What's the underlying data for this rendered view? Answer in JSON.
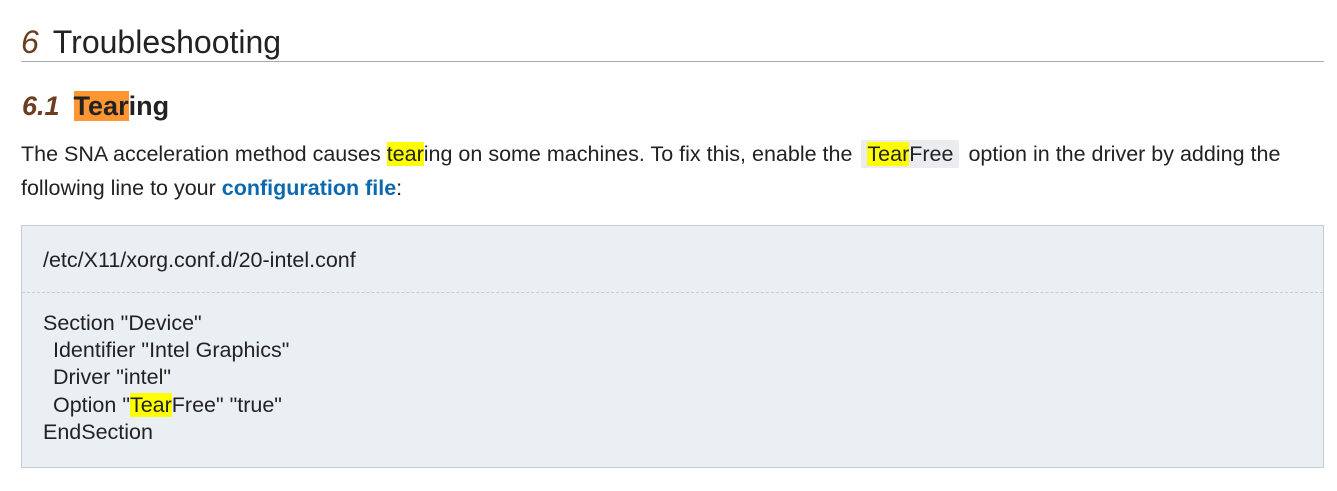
{
  "section": {
    "number": "6",
    "title": "Troubleshooting"
  },
  "subsection": {
    "number": "6.1",
    "title_highlight": "Tear",
    "title_rest": "ing"
  },
  "paragraph": {
    "part1": "The SNA acceleration method causes ",
    "highlight1": "tear",
    "part2": "ing on some machines. To fix this, enable the",
    "code_highlight": "Tear",
    "code_rest": "Free",
    "part3": "option in the driver by adding the following line to your ",
    "link_text": "configuration file",
    "part4": ":"
  },
  "codebox": {
    "filename": "/etc/X11/xorg.conf.d/20-intel.conf",
    "line1": "Section \"Device\"",
    "line2": "Identifier \"Intel Graphics\"",
    "line3": "Driver \"intel\"",
    "line4_pre": "Option \"",
    "line4_highlight": "Tear",
    "line4_post": "Free\" \"true\"",
    "line5": "EndSection"
  },
  "colors": {
    "link": "#0b69b0",
    "section_number": "#6b3e1f",
    "highlight_yellow": "#ffff00",
    "highlight_orange": "#ff9632",
    "codebox_background": "#eaeff4"
  }
}
